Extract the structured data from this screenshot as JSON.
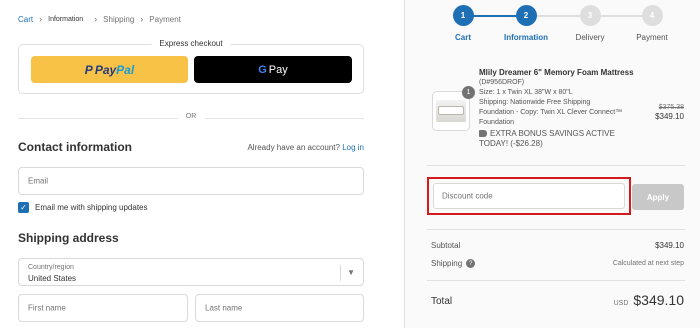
{
  "breadcrumb": {
    "items": [
      {
        "label": "Cart",
        "state": "link"
      },
      {
        "label": "Information",
        "state": "current"
      },
      {
        "label": "Shipping",
        "state": "inactive"
      },
      {
        "label": "Payment",
        "state": "inactive"
      }
    ],
    "separator_icon": "chevron-right-icon"
  },
  "express": {
    "label": "Express checkout",
    "paypal": {
      "part1": "Pay",
      "part2": "Pal",
      "color": "#f7c245"
    },
    "gpay": {
      "g": "G",
      "label": "Pay",
      "color": "#000000"
    }
  },
  "or_label": "OR",
  "contact": {
    "heading": "Contact information",
    "account_prompt": "Already have an account?",
    "login_label": "Log in",
    "email_placeholder": "Email",
    "checkbox_label": "Email me with shipping updates",
    "checkbox_checked": true
  },
  "shipping": {
    "heading": "Shipping address",
    "country_label": "Country/region",
    "country_value": "United States",
    "first_name_placeholder": "First name",
    "last_name_placeholder": "Last name"
  },
  "steps": [
    {
      "num": "1",
      "label": "Cart",
      "active": true
    },
    {
      "num": "2",
      "label": "Information",
      "active": true
    },
    {
      "num": "3",
      "label": "Delivery",
      "active": false
    },
    {
      "num": "4",
      "label": "Payment",
      "active": false
    }
  ],
  "product": {
    "name": "Mlily Dreamer 6\" Memory Foam Mattress",
    "sku": "(D#956DROF)",
    "size": "Size: 1 x Twin XL 38\"W x 80\"L",
    "shipping": "Shipping: Nationwide Free Shipping",
    "foundation": "Foundation - Copy: Twin XL Clever Connect™ Foundation",
    "bonus": "EXTRA BONUS SAVINGS ACTIVE TODAY! (-$26.28)",
    "quantity": "1",
    "price_old": "$375.38",
    "price_now": "$349.10"
  },
  "discount": {
    "placeholder": "Discount code",
    "apply_label": "Apply"
  },
  "summary": {
    "subtotal_label": "Subtotal",
    "subtotal_value": "$349.10",
    "shipping_label": "Shipping",
    "shipping_value": "Calculated at next step",
    "total_label": "Total",
    "currency": "USD",
    "total_value": "$349.10"
  },
  "colors": {
    "accent": "#1f6fb5",
    "highlight_border": "#d21c1c"
  }
}
